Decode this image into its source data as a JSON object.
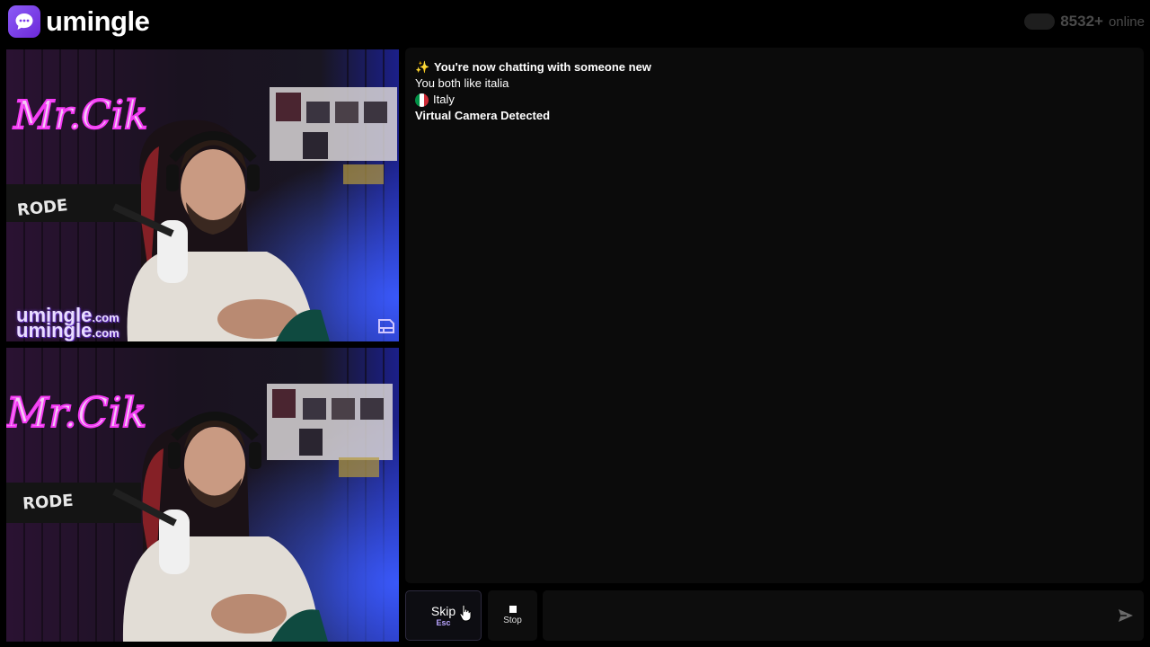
{
  "app": {
    "logo_text": "umingle",
    "online_count": "8532+",
    "online_label": "online"
  },
  "videos": {
    "watermark_main": "umingle",
    "watermark_suffix": ".com",
    "neon_sign": "Mr.Cik",
    "mic_brand": "RODE"
  },
  "chat": {
    "messages": [
      {
        "icon": "sparkles-icon",
        "text": "You're now chatting with someone new",
        "bold": true
      },
      {
        "text": "You both like italia"
      },
      {
        "icon": "italy-flag-icon",
        "text": "Italy"
      },
      {
        "text": "Virtual Camera Detected",
        "bold": true
      }
    ]
  },
  "controls": {
    "skip_label": "Skip",
    "skip_hint": "Esc",
    "stop_label": "Stop",
    "message_placeholder": ""
  },
  "colors": {
    "brand": "#7c3aed",
    "background": "#000000",
    "panel": "#0b0b0b",
    "flag_green": "#009246",
    "flag_white": "#ffffff",
    "flag_red": "#ce2b37"
  }
}
